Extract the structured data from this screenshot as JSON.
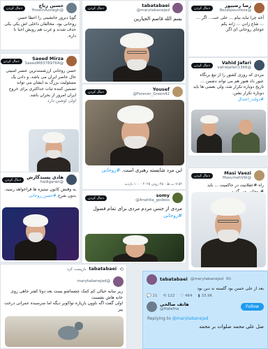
{
  "tweets": {
    "top_left": {
      "name": "حسین زیاچ",
      "handle": "@HoseinAzziagh",
      "follow": "دنبال کردن",
      "text": "گویا دیروز جانشینی را اعطا حسن روحانی بود. مخالفان داخلی اش یکی یکی حذف شدند و غرب هم روبش اجبا نا داره."
    },
    "saeed": {
      "name": "Saeed Mirza",
      "handle": "@SaeedM83789764",
      "follow": "دنبال کردن",
      "text": "حسن روحانی ارزشمندترین عنصر امنیتی حال حاضر ایران می باشد. و دادن یک مسئولیت بزرگ به ایشان می تواند تضمین کننده ثبات حداکثری برای خروج ایران امروز از بحران باشد.",
      "caption": "اولی اوشین دارد"
    },
    "hadi": {
      "name": "هادی پسندگارش",
      "handle": "@hadigaran",
      "follow": "دنبال کردن",
      "text": "به وقتش کانون ستیزه ها فراخواهد رسید.",
      "hashtag": "#حسن_روحانی",
      "prefix": "بدون شرح"
    },
    "top_center": {
      "name": "tabatabaei",
      "handle": "@marytabanejad",
      "follow": "دنبال کردن",
      "text": "بسم الله قاصم الجبارين"
    },
    "yousef": {
      "name": "Yousef",
      "handle": "@Forever_Green42",
      "follow": "دنبال کردن",
      "text": "این مرد شایسته رهبری است.",
      "hashtag": "#روحانی",
      "meta": "۷:۵۲ ب.ظ · ۲۵ ژوئن ۲۰۲۵ · ۱۰۰ بازدید"
    },
    "somy": {
      "name": "somy",
      "handle": "@Anahita_godess",
      "follow": "دنبال کردن",
      "text": "مردی از جنس مردم مردی برای تمام فصول",
      "hashtag": "#روحانی",
      "meta": "۷:۵۷ ب.ظ · ۲۵ ژوئن ۲۰۲۵ · ۳۳۵ بازدید"
    },
    "reza": {
      "name": "رضا رضیپور",
      "handle": "@Rezalpouvfeza",
      "follow": "دنبال کردن",
      "text": "آخه چرا نباید بیام ... علی عب... اگر ... ... شاع زادن ... ژانه یکم",
      "line2": "غوغای روحانی ای اگر."
    },
    "vahid": {
      "name": "Vahid Jafari",
      "handle": "@vahidjafari1366",
      "follow": "دنبال کردن",
      "text": "مردی که روزی کشور را از تیغ برنگاه عبور داد هنوز هم می تواند دشمن ... تاریخ دوباره تکرار شد، ولی بعضی ها باید دوباره تکرار بشن.",
      "hashtag": "#دولت_اعتدال"
    },
    "masi": {
      "name": "Masi Vaezi",
      "handle": "@MasumehVbi",
      "follow": "دنبال کردن",
      "text": "راه #عقلانیت در حاکمیت ... باید #روحانی می گذرد."
    },
    "bottom_left": {
      "name": "tabatabaei",
      "handle": "@marytabanejad",
      "repost": "بازپست کرد",
      "text": "زیر سایه خیالی کم کمک چشماشو بست بعد دوتا کفتر جاهی روی خانه هاش نشست",
      "line2": "اولی گفت اگه ناوون بازیاره تواکوبر دیگه اما سرسبده عمرانی درخت پیر"
    },
    "bottom_right": {
      "name": "tabatabaei",
      "handle": "@marytabanejad",
      "time": "6h",
      "text": "بعد از علی حسن بود گلسته ند دین بود",
      "reply": "21",
      "retweet": "122",
      "like": "464",
      "views": "33.9K",
      "reply_name": "هاتف صالحی",
      "reply_handle": "@Hatefna",
      "follow": "Follow",
      "replying_to_prefix": "Replying to",
      "replying_to": "@marytabanejad",
      "reply_text": "صل علی محمد صلوات بر محمد"
    }
  },
  "colors": {
    "accent": "#1d9bf0",
    "background": "#e6ecf0",
    "highlight": "#c8e6fb"
  }
}
